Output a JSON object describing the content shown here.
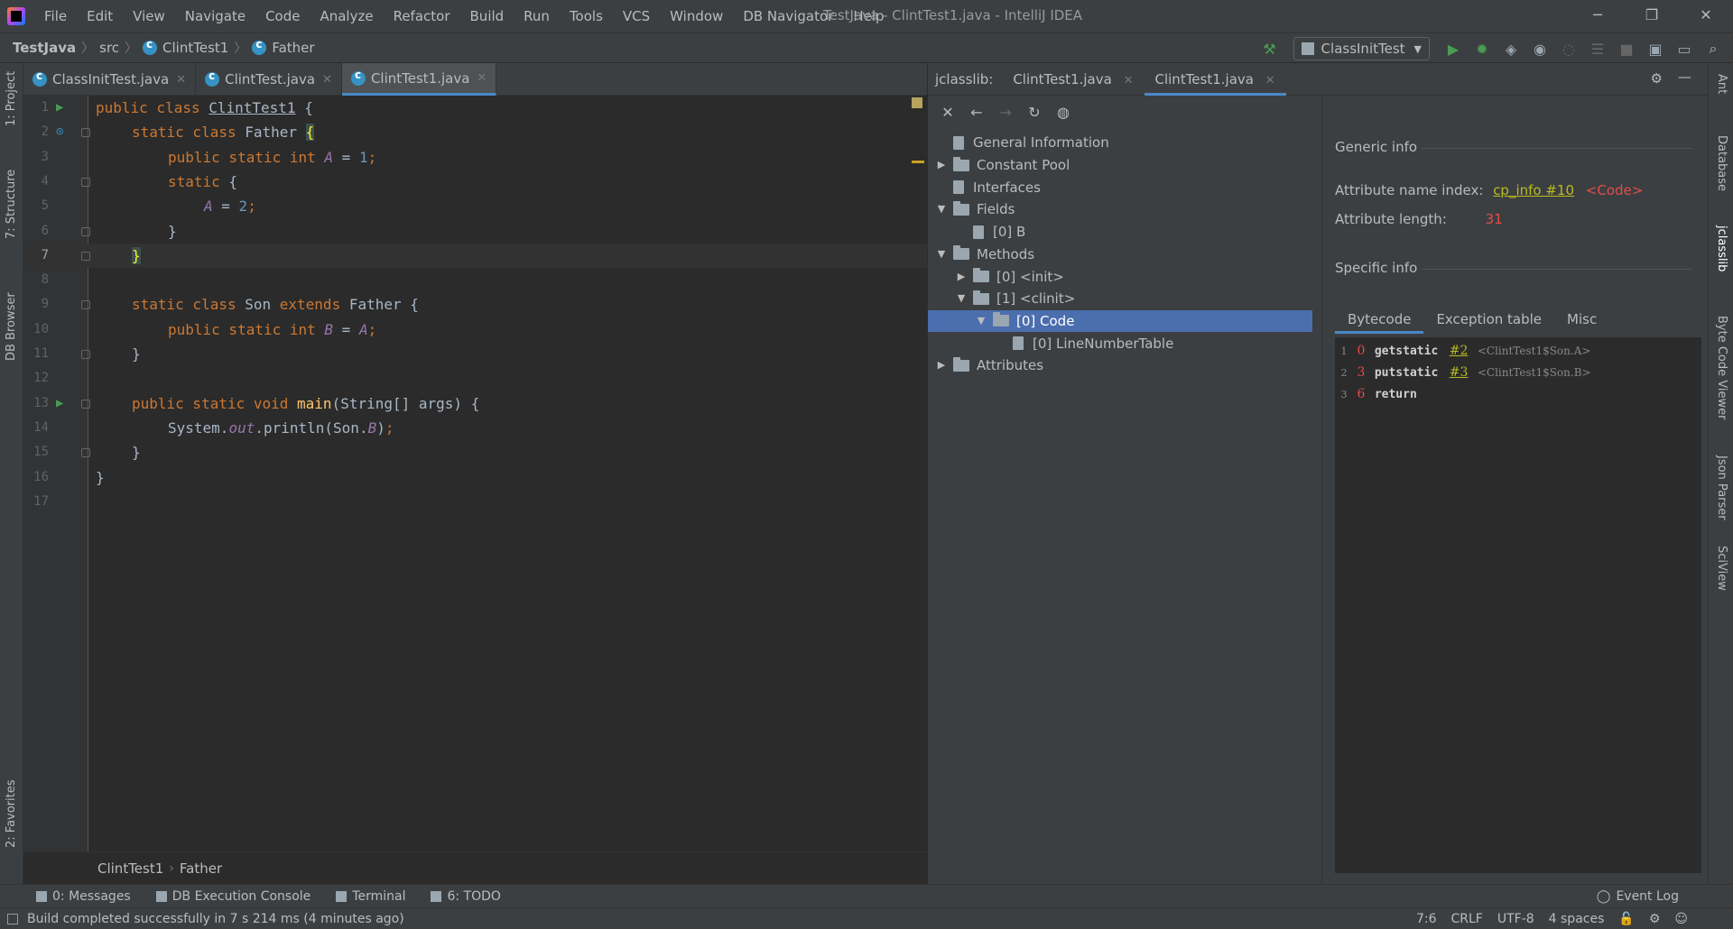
{
  "window": {
    "title": "TestJava - ClintTest1.java - IntelliJ IDEA",
    "minimize": "─",
    "restore": "❐",
    "close": "✕"
  },
  "menu": [
    "File",
    "Edit",
    "View",
    "Navigate",
    "Code",
    "Analyze",
    "Refactor",
    "Build",
    "Run",
    "Tools",
    "VCS",
    "Window",
    "DB Navigator",
    "Help"
  ],
  "navbar": {
    "project": "TestJava",
    "src": "src",
    "class": "ClintTest1",
    "inner": "Father",
    "run_config": "ClassInitTest"
  },
  "left_tools": [
    "1: Project",
    "7: Structure",
    "DB Browser",
    "2: Favorites"
  ],
  "right_tools": [
    "Ant",
    "Database",
    "jclasslib",
    "Byte Code Viewer",
    "Json Parser",
    "SciView"
  ],
  "editor_tabs": [
    {
      "label": "ClassInitTest.java",
      "active": false
    },
    {
      "label": "ClintTest.java",
      "active": false
    },
    {
      "label": "ClintTest1.java",
      "active": true
    }
  ],
  "code_lines": [
    "1",
    "2",
    "3",
    "4",
    "5",
    "6",
    "7",
    "8",
    "9",
    "10",
    "11",
    "12",
    "13",
    "14",
    "15",
    "16",
    "17"
  ],
  "editor_breadcrumb": {
    "class": "ClintTest1",
    "inner": "Father"
  },
  "jclasslib": {
    "title": "jclasslib:",
    "tabs": [
      {
        "label": "ClintTest1.java",
        "active": false
      },
      {
        "label": "ClintTest1.java",
        "active": true
      }
    ],
    "tree": [
      {
        "label": "General Information",
        "depth": 0,
        "kind": "file",
        "expander": ""
      },
      {
        "label": "Constant Pool",
        "depth": 0,
        "kind": "folder",
        "expander": "▶"
      },
      {
        "label": "Interfaces",
        "depth": 0,
        "kind": "file",
        "expander": ""
      },
      {
        "label": "Fields",
        "depth": 0,
        "kind": "folder",
        "expander": "▼"
      },
      {
        "label": "[0] B",
        "depth": 1,
        "kind": "file",
        "expander": ""
      },
      {
        "label": "Methods",
        "depth": 0,
        "kind": "folder",
        "expander": "▼"
      },
      {
        "label": "[0] <init>",
        "depth": 1,
        "kind": "folder",
        "expander": "▶"
      },
      {
        "label": "[1] <clinit>",
        "depth": 1,
        "kind": "folder",
        "expander": "▼"
      },
      {
        "label": "[0] Code",
        "depth": 2,
        "kind": "folder",
        "expander": "▼",
        "selected": true
      },
      {
        "label": "[0] LineNumberTable",
        "depth": 3,
        "kind": "file",
        "expander": ""
      },
      {
        "label": "Attributes",
        "depth": 0,
        "kind": "folder",
        "expander": "▶"
      }
    ],
    "generic_info": "Generic info",
    "attr_name_label": "Attribute name index:",
    "attr_name_link": "cp_info #10",
    "attr_name_value": "<Code>",
    "attr_length_label": "Attribute length:",
    "attr_length_value": "31",
    "specific_info": "Specific info",
    "bytecode_tabs": [
      "Bytecode",
      "Exception table",
      "Misc"
    ],
    "bytecode": [
      {
        "line": "1",
        "offset": "0",
        "op": "getstatic",
        "ref": "#2",
        "comment": "<ClintTest1$Son.A>"
      },
      {
        "line": "2",
        "offset": "3",
        "op": "putstatic",
        "ref": "#3",
        "comment": "<ClintTest1$Son.B>"
      },
      {
        "line": "3",
        "offset": "6",
        "op": "return",
        "ref": "",
        "comment": ""
      }
    ]
  },
  "bottom_tools": [
    "0: Messages",
    "DB Execution Console",
    "Terminal",
    "6: TODO"
  ],
  "event_log": "Event Log",
  "status": {
    "message": "Build completed successfully in 7 s 214 ms (4 minutes ago)",
    "position": "7:6",
    "line_sep": "CRLF",
    "encoding": "UTF-8",
    "indent": "4 spaces"
  },
  "colors": {
    "accent": "#4a88c7",
    "selection": "#4b6eaf",
    "keyword": "#cc7832",
    "number": "#6897bb",
    "field": "#9876aa",
    "method": "#ffc66d",
    "link": "#b9bb20",
    "error_red": "#e54c4c"
  }
}
